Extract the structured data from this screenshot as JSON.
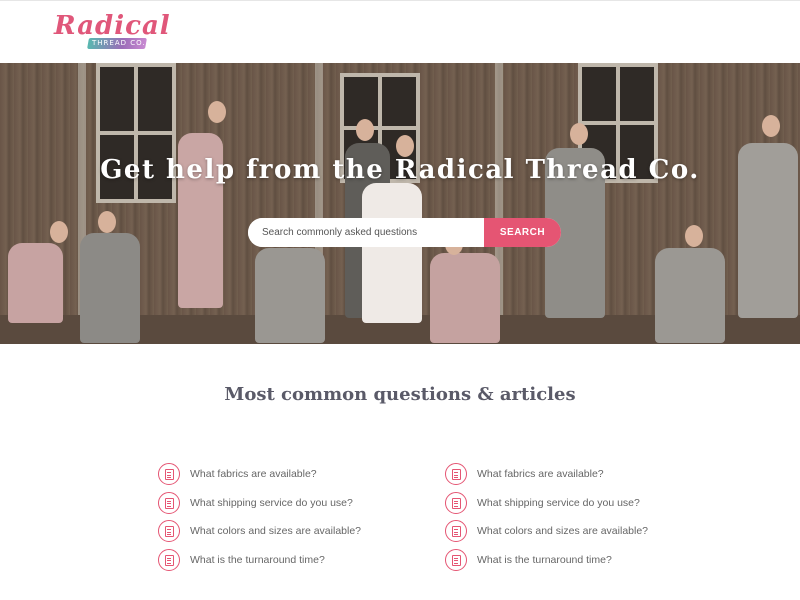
{
  "header": {
    "logo_text": "Radical",
    "logo_sub": "THREAD CO."
  },
  "hero": {
    "title": "Get help from the Radical Thread Co.",
    "search": {
      "placeholder": "Search commonly asked questions",
      "button_label": "SEARCH"
    }
  },
  "faq": {
    "title": "Most common questions & articles",
    "left": [
      {
        "label": "What fabrics are available?"
      },
      {
        "label": "What shipping service do you use?"
      },
      {
        "label": "What colors and sizes are available?"
      },
      {
        "label": "What is the turnaround time?"
      }
    ],
    "right": [
      {
        "label": "What fabrics are available?"
      },
      {
        "label": "What shipping service do you use?"
      },
      {
        "label": "What colors and sizes are available?"
      },
      {
        "label": "What is the turnaround time?"
      }
    ]
  },
  "colors": {
    "accent": "#e55573",
    "teal": "#58b8b0",
    "text": "#666666"
  },
  "icons": [
    "document-icon"
  ]
}
